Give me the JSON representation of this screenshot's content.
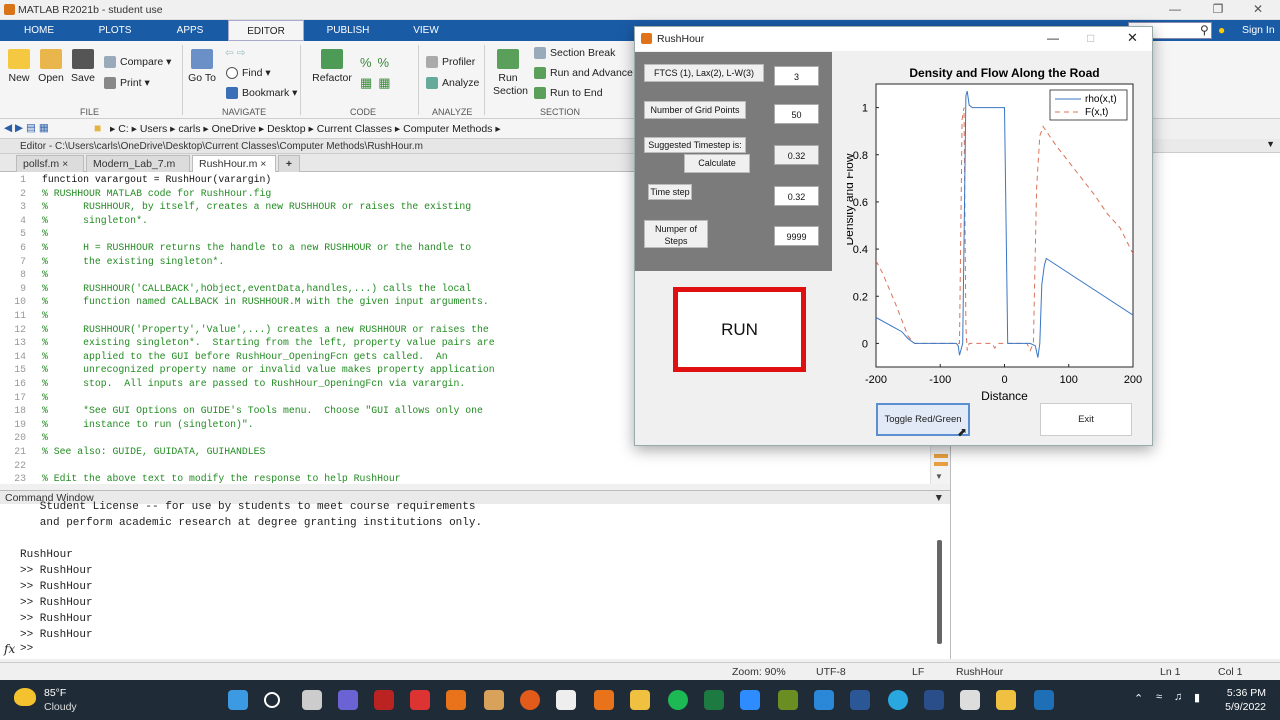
{
  "app": {
    "title": "MATLAB R2021b - student use"
  },
  "tabs": [
    "HOME",
    "PLOTS",
    "APPS",
    "EDITOR",
    "PUBLISH",
    "VIEW"
  ],
  "ribbon": {
    "file": {
      "new": "New",
      "open": "Open",
      "save": "Save",
      "compare": "Compare",
      "print": "Print",
      "section": "FILE"
    },
    "navigate": {
      "goto": "Go To",
      "find": "Find",
      "bookmark": "Bookmark",
      "section": "NAVIGATE"
    },
    "code": {
      "refactor": "Refactor",
      "section": "CODE"
    },
    "analyze": {
      "profiler": "Profiler",
      "analyze": "Analyze",
      "section": "ANALYZE"
    },
    "section": {
      "run_section": "Run Section",
      "section_break": "Section Break",
      "run_advance": "Run and Advance",
      "run_end": "Run to End",
      "section": "SECTION"
    }
  },
  "toolbar": {
    "search_placeholder": "",
    "signin": "Sign In"
  },
  "address": [
    "C:",
    "Users",
    "carls",
    "OneDrive",
    "Desktop",
    "Current Classes",
    "Computer Methods"
  ],
  "editor": {
    "header": "Editor - C:\\Users\\carls\\OneDrive\\Desktop\\Current Classes\\Computer Methods\\RushHour.m",
    "files": [
      "pollsf.m",
      "Modern_Lab_7.m",
      "RushHour.m"
    ],
    "lines": [
      "function varargout = RushHour(varargin)",
      "% RUSHHOUR MATLAB code for RushHour.fig",
      "%      RUSHHOUR, by itself, creates a new RUSHHOUR or raises the existing",
      "%      singleton*.",
      "%",
      "%      H = RUSHHOUR returns the handle to a new RUSHHOUR or the handle to",
      "%      the existing singleton*.",
      "%",
      "%      RUSHHOUR('CALLBACK',hObject,eventData,handles,...) calls the local",
      "%      function named CALLBACK in RUSHHOUR.M with the given input arguments.",
      "%",
      "%      RUSHHOUR('Property','Value',...) creates a new RUSHHOUR or raises the",
      "%      existing singleton*.  Starting from the left, property value pairs are",
      "%      applied to the GUI before RushHour_OpeningFcn gets called.  An",
      "%      unrecognized property name or invalid value makes property application",
      "%      stop.  All inputs are passed to RushHour_OpeningFcn via varargin.",
      "%",
      "%      *See GUI Options on GUIDE's Tools menu.  Choose \"GUI allows only one",
      "%      instance to run (singleton)\".",
      "%",
      "% See also: GUIDE, GUIDATA, GUIHANDLES",
      "",
      "% Edit the above text to modify the response to help RushHour"
    ]
  },
  "command_window": {
    "title": "Command Window",
    "lines": [
      "   Student License -- for use by students to meet course requirements",
      "   and perform academic research at degree granting institutions only.",
      "",
      "RushHour",
      ">> RushHour",
      ">> RushHour",
      ">> RushHour",
      ">> RushHour",
      ">> RushHour"
    ],
    "prompt": ">>"
  },
  "right_panel": {
    "title": "RushHour"
  },
  "status": {
    "zoom": "Zoom: 90%",
    "encoding": "UTF-8",
    "eol": "LF",
    "file": "RushHour",
    "ln": "Ln  1",
    "col": "Col  1"
  },
  "taskbar": {
    "temp": "85°F",
    "weather": "Cloudy",
    "time": "5:36 PM",
    "date": "5/9/2022"
  },
  "dialog": {
    "title": "RushHour",
    "labels": {
      "scheme": "FTCS (1), Lax(2), L-W(3)",
      "grid": "Number of Grid Points",
      "suggested": "Suggested Timestep is:",
      "calculate": "Calculate",
      "timestep": "Time step",
      "steps": "Numper of Steps"
    },
    "values": {
      "scheme": "3",
      "grid": "50",
      "suggested": "0.32",
      "timestep": "0.32",
      "steps": "9999"
    },
    "run": "RUN",
    "toggle": "Toggle Red/Green",
    "exit": "Exit"
  },
  "chart_data": {
    "type": "line",
    "title": "Density and Flow Along the Road",
    "xlabel": "Distance",
    "ylabel": "Density and Flow",
    "xlim": [
      -200,
      200
    ],
    "ylim": [
      -0.1,
      1.1
    ],
    "xticks": [
      -200,
      -100,
      0,
      100,
      200
    ],
    "yticks": [
      0,
      0.2,
      0.4,
      0.6,
      0.8,
      1
    ],
    "legend_position": "top-right",
    "series": [
      {
        "name": "rho(x,t)",
        "color": "#3a76c4",
        "dash": "",
        "x": [
          -200,
          -180,
          -160,
          -150,
          -140,
          -75,
          -72,
          -70,
          -65,
          -60,
          -58,
          -55,
          -50,
          -40,
          -30,
          -20,
          -10,
          0,
          5,
          10,
          20,
          30,
          40,
          48,
          52,
          55,
          58,
          62,
          65,
          200
        ],
        "y": [
          0.11,
          0.08,
          0.05,
          0.02,
          0.0,
          0.0,
          -0.01,
          -0.05,
          0.0,
          1.05,
          1.07,
          1.01,
          1.0,
          1.0,
          1.0,
          1.0,
          1.0,
          1.0,
          0.0,
          0.0,
          0.0,
          0.0,
          0.0,
          -0.01,
          -0.06,
          0.0,
          0.25,
          0.33,
          0.36,
          0.12
        ]
      },
      {
        "name": "F(x,t)",
        "color": "#d9735a",
        "dash": "5,4",
        "x": [
          -200,
          -190,
          -170,
          -150,
          -140,
          -90,
          -80,
          -75,
          -70,
          -66,
          -63,
          -60,
          -58,
          -55,
          -50,
          -45,
          -40,
          -35,
          -30,
          -25,
          -20,
          -15,
          -10,
          0,
          10,
          20,
          30,
          35,
          40,
          45,
          50,
          55,
          60,
          80,
          100,
          120,
          140,
          160,
          180,
          200
        ],
        "y": [
          0.35,
          0.3,
          0.17,
          0.03,
          0.0,
          0.0,
          0.0,
          0.0,
          0.0,
          0.95,
          1.0,
          0.07,
          -0.03,
          0.0,
          0.0,
          0.0,
          0.0,
          0.0,
          0.0,
          0.0,
          0.0,
          -0.02,
          0.0,
          0.0,
          0.0,
          0.0,
          0.0,
          0.0,
          -0.03,
          0.0,
          0.66,
          0.88,
          0.92,
          0.84,
          0.77,
          0.7,
          0.63,
          0.55,
          0.49,
          0.38
        ]
      }
    ]
  }
}
